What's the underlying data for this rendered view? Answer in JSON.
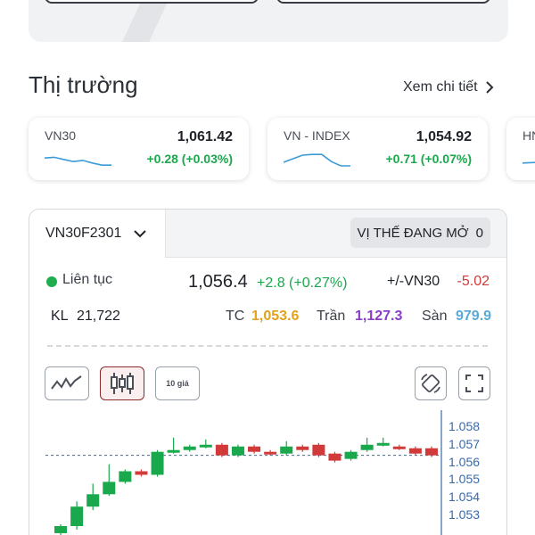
{
  "market": {
    "title": "Thị trường",
    "see_more": "Xem chi tiết",
    "indices": [
      {
        "name": "VN30",
        "value": "1,061.42",
        "change": "+0.28 (+0.03%)",
        "spark": [
          0.55,
          0.6,
          0.45,
          0.3,
          0.38,
          0.2,
          0.05,
          0.05
        ]
      },
      {
        "name": "VN - INDEX",
        "value": "1,054.92",
        "change": "+0.71 (+0.07%)",
        "spark": [
          0.25,
          0.5,
          0.75,
          0.8,
          0.8,
          0.3,
          0.0,
          0.0
        ]
      },
      {
        "name": "HN",
        "value": "",
        "change": "",
        "spark": [
          0.2,
          0.4
        ]
      }
    ]
  },
  "futures": {
    "symbol": "VN30F2301",
    "open_positions_label": "VỊ THẾ ĐANG MỞ",
    "open_positions_count": "0",
    "status": "Liên tục",
    "last_price": "1,056.4",
    "change": "+2.8 (+0.27%)",
    "basis_label": "+/-VN30",
    "basis_value": "-5.02",
    "volume_label": "KL",
    "volume_value": "21,722",
    "ref_label": "TC",
    "ref_value": "1,053.6",
    "ceiling_label": "Trần",
    "ceiling_value": "1,127.3",
    "floor_label": "Sàn",
    "floor_value": "979.9",
    "tools": {
      "level_label": "10 giá"
    }
  },
  "colors": {
    "up": "#1aa84c",
    "down": "#d23a3a",
    "ref": "#e4a21b",
    "ceiling": "#8a3cc8",
    "floor": "#5aa9d6",
    "axis": "#3a6aa8"
  },
  "chart_data": {
    "type": "candlestick",
    "y_ticks": [
      "1.058",
      "1.057",
      "1.056",
      "1.055",
      "1.054",
      "1.053"
    ],
    "ylim": [
      1.0524,
      1.0584
    ],
    "reference_line": 1.0564,
    "candles": [
      {
        "o": 1.052,
        "c": 1.0524,
        "h": 1.0525,
        "l": 1.0519
      },
      {
        "o": 1.0524,
        "c": 1.0535,
        "h": 1.0538,
        "l": 1.0522
      },
      {
        "o": 1.0535,
        "c": 1.0542,
        "h": 1.0548,
        "l": 1.0533
      },
      {
        "o": 1.0542,
        "c": 1.0549,
        "h": 1.0559,
        "l": 1.0541
      },
      {
        "o": 1.0549,
        "c": 1.0555,
        "h": 1.0556,
        "l": 1.0548
      },
      {
        "o": 1.0555,
        "c": 1.0553,
        "h": 1.0556,
        "l": 1.0552
      },
      {
        "o": 1.0553,
        "c": 1.0566,
        "h": 1.0567,
        "l": 1.0552
      },
      {
        "o": 1.0566,
        "c": 1.0567,
        "h": 1.0574,
        "l": 1.0565
      },
      {
        "o": 1.0567,
        "c": 1.0569,
        "h": 1.057,
        "l": 1.0566
      },
      {
        "o": 1.0569,
        "c": 1.057,
        "h": 1.0573,
        "l": 1.0568
      },
      {
        "o": 1.057,
        "c": 1.0564,
        "h": 1.0571,
        "l": 1.0563
      },
      {
        "o": 1.0564,
        "c": 1.0569,
        "h": 1.057,
        "l": 1.0563
      },
      {
        "o": 1.0569,
        "c": 1.0566,
        "h": 1.057,
        "l": 1.0565
      },
      {
        "o": 1.0566,
        "c": 1.0565,
        "h": 1.0567,
        "l": 1.0564
      },
      {
        "o": 1.0565,
        "c": 1.0569,
        "h": 1.0572,
        "l": 1.0564
      },
      {
        "o": 1.0569,
        "c": 1.0567,
        "h": 1.057,
        "l": 1.0566
      },
      {
        "o": 1.057,
        "c": 1.0564,
        "h": 1.0571,
        "l": 1.0563
      },
      {
        "o": 1.0565,
        "c": 1.0561,
        "h": 1.0566,
        "l": 1.056
      },
      {
        "o": 1.0562,
        "c": 1.0566,
        "h": 1.0567,
        "l": 1.0561
      },
      {
        "o": 1.0567,
        "c": 1.057,
        "h": 1.0574,
        "l": 1.0566
      },
      {
        "o": 1.057,
        "c": 1.0571,
        "h": 1.0574,
        "l": 1.0569
      },
      {
        "o": 1.0569,
        "c": 1.0568,
        "h": 1.057,
        "l": 1.0567
      },
      {
        "o": 1.0568,
        "c": 1.0565,
        "h": 1.0569,
        "l": 1.0564
      },
      {
        "o": 1.0568,
        "c": 1.0564,
        "h": 1.0569,
        "l": 1.0563
      }
    ]
  }
}
